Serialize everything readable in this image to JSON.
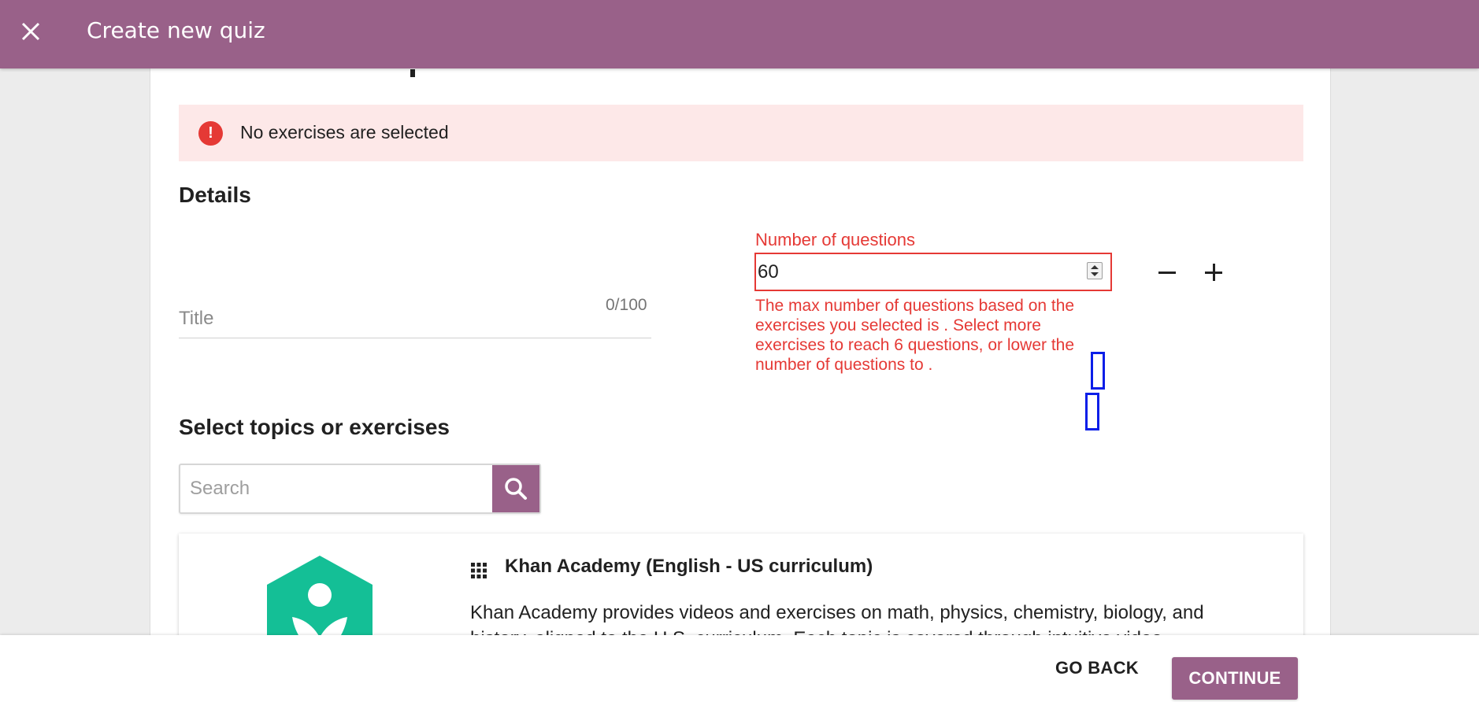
{
  "appbar": {
    "title": "Create new quiz",
    "color": "#996189"
  },
  "alert": {
    "message": "No exercises are selected"
  },
  "details": {
    "heading": "Details",
    "title_placeholder": "Title",
    "title_value": "",
    "title_counter": "0/100"
  },
  "num_questions": {
    "label": "Number of questions",
    "value": "60",
    "error": "The max number of questions based on the exercises you selected is . Select more exercises to reach 6 questions, or lower the number of questions to ."
  },
  "topics": {
    "heading": "Select topics or exercises",
    "search_placeholder": "Search"
  },
  "channel_card": {
    "title": "Khan Academy (English - US curriculum)",
    "description": "Khan Academy provides videos and exercises on math, physics, chemistry, biology, and history, aligned to the U.S. curriculum. Each topic is covered through intuitive video"
  },
  "footer": {
    "go_back_label": "GO BACK",
    "continue_label": "CONTINUE"
  },
  "colors": {
    "brand": "#996189",
    "error": "#e53935",
    "alert_bg": "#fde8e8",
    "khan_green": "#14bf96"
  }
}
